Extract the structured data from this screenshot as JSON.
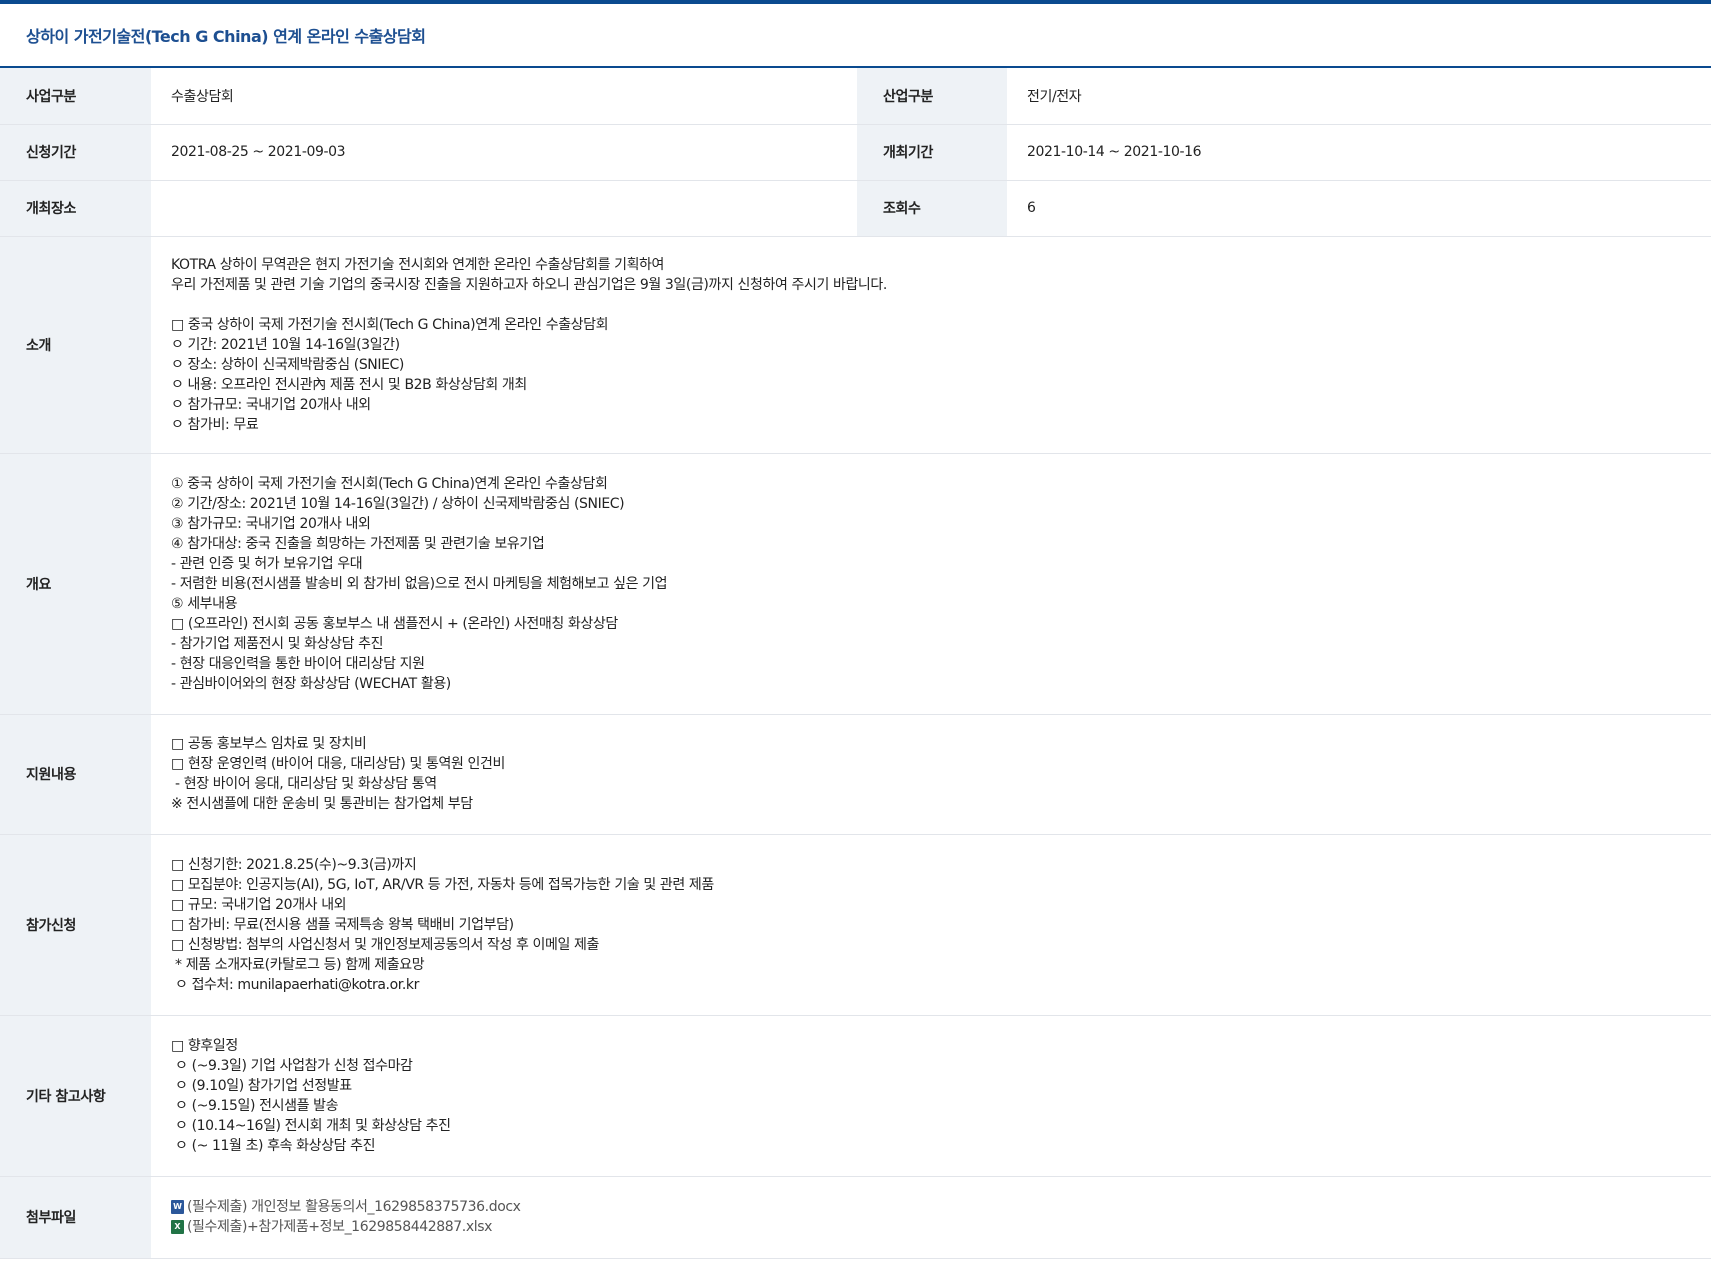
{
  "title": "상하이 가전기술전(Tech G China) 연계 온라인 수출상담회",
  "fields": {
    "biz_type": {
      "label": "사업구분",
      "value": "수출상담회"
    },
    "industry": {
      "label": "산업구분",
      "value": "전기/전자"
    },
    "apply_period": {
      "label": "신청기간",
      "value": "2021-08-25 ~ 2021-09-03"
    },
    "event_period": {
      "label": "개최기간",
      "value": "2021-10-14 ~ 2021-10-16"
    },
    "venue": {
      "label": "개최장소",
      "value": ""
    },
    "views": {
      "label": "조회수",
      "value": "6"
    }
  },
  "sections": [
    {
      "label": "소개",
      "lines": [
        "KOTRA 상하이 무역관은 현지 가전기술 전시회와 연계한 온라인 수출상담회를 기획하여",
        "우리 가전제품 및 관련 기술 기업의 중국시장 진출을 지원하고자 하오니 관심기업은 9월 3일(금)까지 신청하여 주시기 바랍니다.",
        "",
        "□ 중국 상하이 국제 가전기술 전시회(Tech G China)연계 온라인 수출상담회",
        "ㅇ 기간: 2021년 10월 14-16일(3일간)",
        "ㅇ 장소: 상하이 신국제박람중심 (SNIEC)",
        "ㅇ 내용: 오프라인 전시관內 제품 전시 및 B2B 화상상담회 개최",
        "ㅇ 참가규모: 국내기업 20개사 내외",
        "ㅇ 참가비: 무료"
      ]
    },
    {
      "label": "개요",
      "lines": [
        "① 중국 상하이 국제 가전기술 전시회(Tech G China)연계 온라인 수출상담회",
        "② 기간/장소: 2021년 10월 14-16일(3일간) / 상하이 신국제박람중심 (SNIEC)",
        "③ 참가규모: 국내기업 20개사 내외",
        "④ 참가대상: 중국 진출을 희망하는 가전제품 및 관련기술 보유기업",
        "- 관련 인증 및 허가 보유기업 우대",
        "- 저렴한 비용(전시샘플 발송비 외 참가비 없음)으로 전시 마케팅을 체험해보고 싶은 기업",
        "⑤ 세부내용",
        "□ (오프라인) 전시회 공동 홍보부스 내 샘플전시 + (온라인) 사전매칭 화상상담",
        "- 참가기업 제품전시 및 화상상담 추진",
        "- 현장 대응인력을 통한 바이어 대리상담 지원",
        "- 관심바이어와의 현장 화상상담 (WECHAT 활용)"
      ]
    },
    {
      "label": "지원내용",
      "lines": [
        "□ 공동 홍보부스 임차료 및 장치비",
        "□ 현장 운영인력 (바이어 대응, 대리상담) 및 통역원 인건비",
        " - 현장 바이어 응대, 대리상담 및 화상상담 통역",
        "※ 전시샘플에 대한 운송비 및 통관비는 참가업체 부담"
      ]
    },
    {
      "label": "참가신청",
      "lines": [
        "□ 신청기한: 2021.8.25(수)~9.3(금)까지",
        "□ 모집분야: 인공지능(AI), 5G, IoT, AR/VR 등 가전, 자동차 등에 접목가능한 기술 및 관련 제품",
        "□ 규모: 국내기업 20개사 내외",
        "□ 참가비: 무료(전시용 샘플 국제특송 왕복 택배비 기업부담)",
        "□ 신청방법: 첨부의 사업신청서 및 개인정보제공동의서 작성 후 이메일 제출",
        " * 제품 소개자료(카탈로그 등) 함께 제출요망",
        " ㅇ 접수처: munilapaerhati@kotra.or.kr"
      ]
    },
    {
      "label": "기타 참고사항",
      "lines": [
        "□ 향후일정",
        " ㅇ (~9.3일) 기업 사업참가 신청 접수마감",
        " ㅇ (9.10일) 참가기업 선정발표",
        " ㅇ (~9.15일) 전시샘플 발송",
        " ㅇ (10.14~16일) 전시회 개최 및 화상상담 추진",
        " ㅇ (~ 11월 초) 후속 화상상담 추진"
      ]
    }
  ],
  "attachments": {
    "label": "첨부파일",
    "files": [
      {
        "name": "(필수제출) 개인정보 활용동의서_1629858375736.docx",
        "icon": "word-file-icon"
      },
      {
        "name": "(필수제출)+참가제품+정보_1629858442887.xlsx",
        "icon": "excel-file-icon"
      }
    ]
  },
  "colors": {
    "accent": "#0a4a8f",
    "title": "#1d4f91",
    "header_cell_bg": "#eef2f6",
    "border": "#e2e5ea"
  }
}
